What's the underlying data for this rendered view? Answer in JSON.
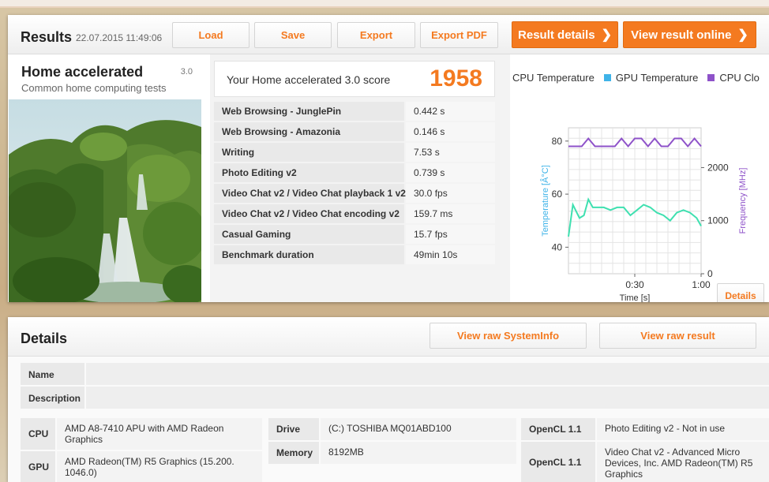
{
  "results": {
    "title": "Results",
    "date": "22.07.2015 11:49:06",
    "buttons": {
      "load": "Load",
      "save": "Save",
      "export": "Export",
      "export_pdf": "Export PDF",
      "result_details": "Result details",
      "view_online": "View result online"
    }
  },
  "test": {
    "name": "Home accelerated",
    "version": "3.0",
    "description": "Common home computing tests"
  },
  "score": {
    "label": "Your Home accelerated 3.0 score",
    "value": "1958"
  },
  "rows": [
    {
      "k": "Web Browsing - JunglePin",
      "v": "0.442 s"
    },
    {
      "k": "Web Browsing - Amazonia",
      "v": "0.146 s"
    },
    {
      "k": "Writing",
      "v": "7.53 s"
    },
    {
      "k": "Photo Editing v2",
      "v": "0.739 s"
    },
    {
      "k": "Video Chat v2 / Video Chat playback 1 v2",
      "v": "30.0 fps"
    },
    {
      "k": "Video Chat v2 / Video Chat encoding v2",
      "v": "159.7 ms"
    },
    {
      "k": "Casual Gaming",
      "v": "15.7 fps"
    },
    {
      "k": "Benchmark duration",
      "v": "49min 10s"
    }
  ],
  "chart_data": {
    "type": "line",
    "legend": [
      "CPU Temperature",
      "GPU Temperature",
      "CPU Clo"
    ],
    "colors": {
      "cpu_temp": "#3fe0b0",
      "gpu_temp": "#3fb3e8",
      "cpu_clock": "#8e52c9"
    },
    "xlabel": "Time [s]",
    "ylabel_left": "Temperature [Â°C]",
    "ylabel_right": "Frequency [MHz]",
    "x_ticks": [
      "0:30",
      "1:00"
    ],
    "y_left_ticks": [
      "40",
      "60",
      "80"
    ],
    "y_right_ticks": [
      "0",
      "1000",
      "2000"
    ],
    "xlim": [
      0,
      60
    ],
    "ylim_left": [
      30,
      85
    ],
    "ylim_right": [
      0,
      2750
    ],
    "series": [
      {
        "name": "CPU Temperature",
        "axis": "left",
        "x": [
          0,
          2,
          5,
          7,
          9,
          11,
          13,
          16,
          19,
          22,
          25,
          28,
          31,
          34,
          37,
          40,
          43,
          46,
          49,
          52,
          55,
          58,
          60
        ],
        "values": [
          44,
          56,
          51,
          52,
          58,
          55,
          55,
          55,
          54,
          55,
          55,
          52,
          54,
          56,
          55,
          53,
          52,
          50,
          53,
          54,
          53,
          51,
          48
        ]
      },
      {
        "name": "CPU Clock",
        "axis": "right",
        "x": [
          0,
          3,
          6,
          9,
          12,
          15,
          18,
          21,
          24,
          27,
          30,
          33,
          36,
          39,
          42,
          45,
          48,
          51,
          54,
          57,
          60
        ],
        "values": [
          2400,
          2400,
          2400,
          2550,
          2400,
          2400,
          2400,
          2400,
          2550,
          2400,
          2550,
          2550,
          2400,
          2550,
          2400,
          2400,
          2550,
          2550,
          2400,
          2550,
          2400
        ]
      }
    ]
  },
  "chart_details_button": "Details",
  "details": {
    "title": "Details",
    "view_sysinfo": "View raw SystemInfo",
    "view_result": "View raw result",
    "name_label": "Name",
    "description_label": "Description",
    "cpu_label": "CPU",
    "cpu_value": "AMD A8-7410 APU with AMD Radeon Graphics",
    "gpu_label": "GPU",
    "gpu_value": "AMD Radeon(TM) R5 Graphics (15.200. 1046.0)",
    "drive_label": "Drive",
    "drive_value": "(C:) TOSHIBA MQ01ABD100",
    "memory_label": "Memory",
    "memory_value": "8192MB",
    "opencl1_label": "OpenCL 1.1",
    "opencl1_value": "Photo Editing v2 - Not in use",
    "opencl2_label": "OpenCL 1.1",
    "opencl2_value": "Video Chat v2 - Advanced Micro Devices, Inc. AMD Radeon(TM) R5 Graphics"
  }
}
